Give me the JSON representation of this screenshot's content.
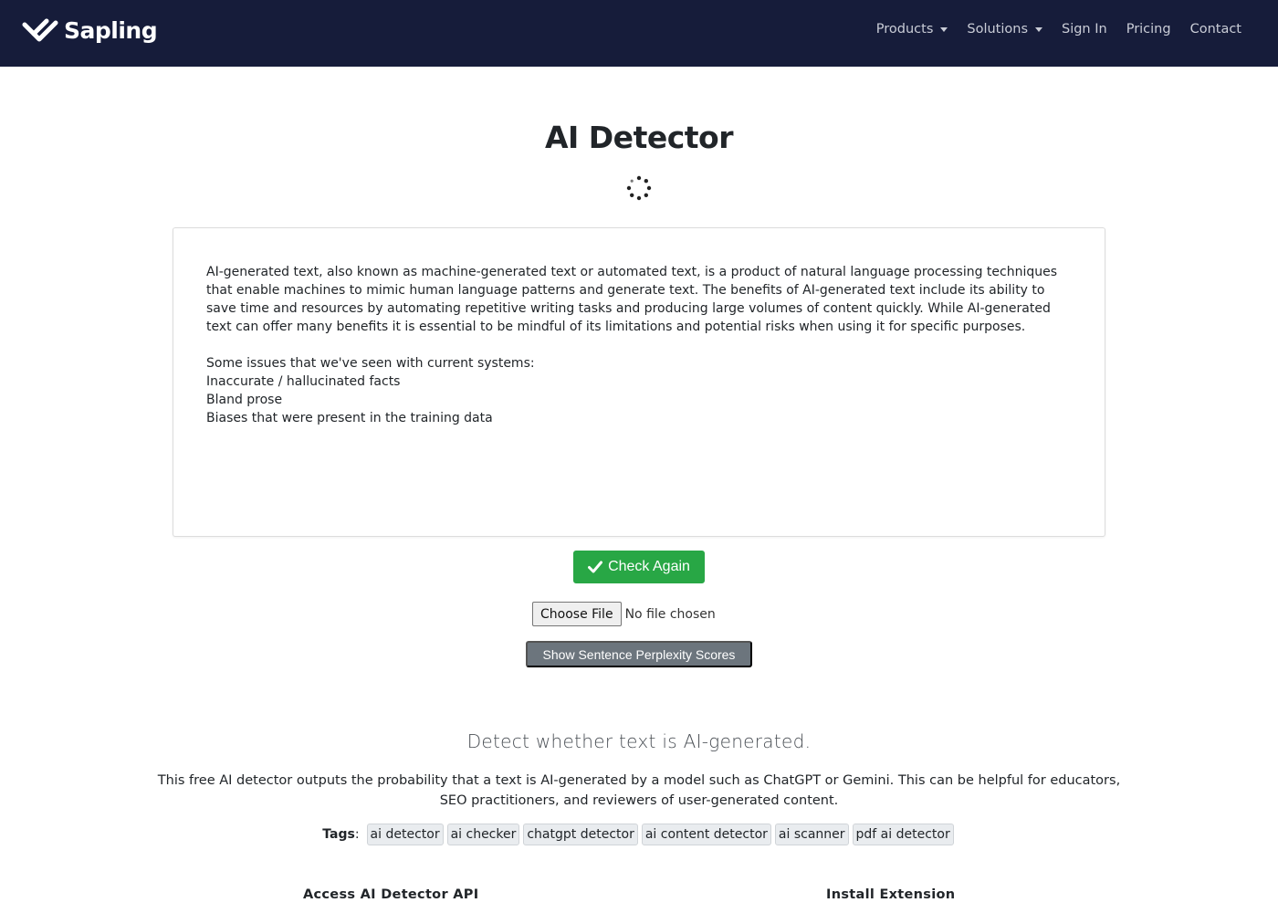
{
  "nav": {
    "brand": "Sapling",
    "items": [
      {
        "label": "Products",
        "dropdown": true
      },
      {
        "label": "Solutions",
        "dropdown": true
      },
      {
        "label": "Sign In",
        "dropdown": false
      },
      {
        "label": "Pricing",
        "dropdown": false
      },
      {
        "label": "Contact",
        "dropdown": false
      }
    ]
  },
  "main": {
    "title": "AI Detector",
    "editor": {
      "paragraph1": "AI-generated text, also known as machine-generated text or automated text, is a product of natural language processing techniques that enable machines to mimic human language patterns and generate text. The benefits of AI-generated text include its ability to save time and resources by automating repetitive writing tasks and producing large volumes of content quickly. While AI-generated text can offer many benefits it is essential to be mindful of its limitations and potential risks when using it for specific purposes.",
      "lines": [
        "Some issues that we've seen with current systems:",
        "Inaccurate / hallucinated facts",
        "Bland prose",
        "Biases that were present in the training data"
      ]
    },
    "check_button": "Check Again",
    "file": {
      "button": "Choose File",
      "status": "No file chosen"
    },
    "perplexity_button": "Show Sentence Perplexity Scores"
  },
  "info": {
    "subtitle": "Detect whether text is AI-generated.",
    "description": "This free AI detector outputs the probability that a text is AI-generated by a model such as ChatGPT or Gemini. This can be helpful for educators, SEO practitioners, and reviewers of user-generated content.",
    "tags_label": "Tags",
    "tags": [
      "ai detector",
      "ai checker",
      "chatgpt detector",
      "ai content detector",
      "ai scanner",
      "pdf ai detector"
    ]
  },
  "footer": {
    "api_heading": "Access AI Detector API",
    "extension_heading": "Install Extension"
  },
  "colors": {
    "navbar": "#161c3a",
    "check_button": "#28a745",
    "secondary_button": "#6c757d"
  },
  "icons": [
    "sapling-logo-icon",
    "caret-down-icon",
    "loading-spinner-icon",
    "checkmark-icon"
  ]
}
